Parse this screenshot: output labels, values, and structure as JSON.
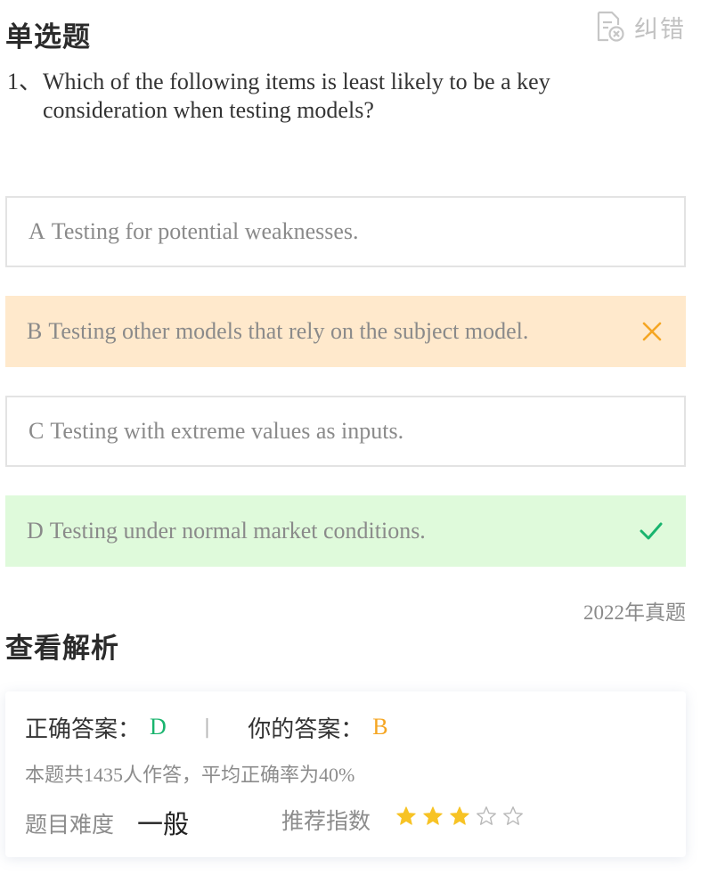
{
  "header": {
    "question_type": "单选题",
    "report_label": "纠错"
  },
  "question": {
    "number": "1、",
    "text": "Which of the following items is least likely to be a key consideration when testing models?"
  },
  "options": [
    {
      "letter": "A",
      "text": "Testing for potential weaknesses.",
      "state": "normal"
    },
    {
      "letter": "B",
      "text": "Testing other models that rely on the subject model.",
      "state": "wrong",
      "mark_icon": "cross-icon"
    },
    {
      "letter": "C",
      "text": "Testing with extreme values as inputs.",
      "state": "normal"
    },
    {
      "letter": "D",
      "text": "Testing under normal market conditions.",
      "state": "correct",
      "mark_icon": "check-icon"
    }
  ],
  "source": "2022年真题",
  "analysis": {
    "title": "查看解析",
    "correct_label": "正确答案：",
    "correct_value": "D",
    "separator": "|",
    "your_label": "你的答案：",
    "your_value": "B",
    "stats": "本题共1435人作答，平均正确率为40%",
    "difficulty_label": "题目难度",
    "difficulty_value": "一般",
    "recommend_label": "推荐指数",
    "rating": 3,
    "rating_max": 5
  },
  "colors": {
    "correct": "#19b46e",
    "wrong": "#f5a623",
    "star_filled": "#f7c325",
    "star_empty": "#b8b8b8"
  }
}
